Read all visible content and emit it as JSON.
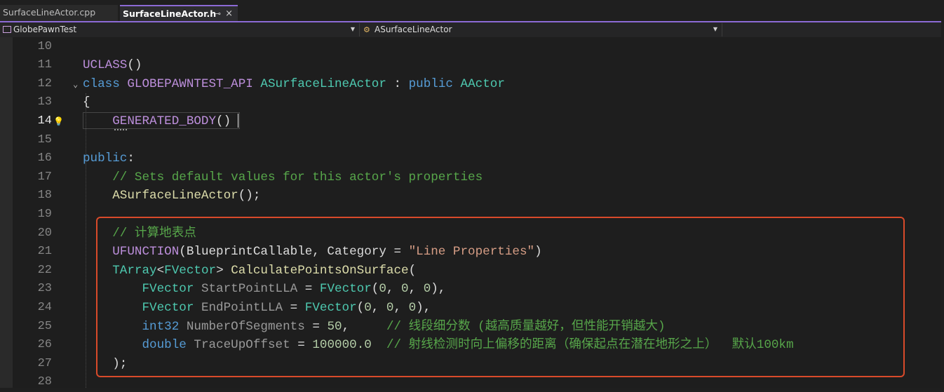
{
  "tabs": [
    {
      "label": "SurfaceLineActor.cpp",
      "active": false
    },
    {
      "label": "SurfaceLineActor.h",
      "active": true,
      "pin_icon": "pin-icon",
      "close_icon": "close-icon"
    }
  ],
  "tab_pin_glyph": "⊸",
  "tab_close_glyph": "×",
  "navbar": {
    "project": "GlobePawnTest",
    "scope": "ASurfaceLineActor",
    "member": ""
  },
  "colors": {
    "accent": "#8c6ad6",
    "highlight_border": "#d94a2a",
    "keyword": "#569cd6",
    "type": "#4ec9b0",
    "macro": "#bd8fdc",
    "function": "#dcdcaa",
    "comment": "#57a64a",
    "string": "#d69d85",
    "number": "#b5cea8"
  },
  "current_line": "14",
  "lines": [
    {
      "num": "10",
      "tokens": []
    },
    {
      "num": "11",
      "tokens": [
        [
          "mac",
          "UCLASS"
        ],
        [
          "pl",
          "()"
        ]
      ]
    },
    {
      "num": "12",
      "fold": true,
      "tokens": [
        [
          "kw",
          "class"
        ],
        [
          "pl",
          " "
        ],
        [
          "mac",
          "GLOBEPAWNTEST_API"
        ],
        [
          "pl",
          " "
        ],
        [
          "ty",
          "ASurfaceLineActor"
        ],
        [
          "pl",
          " : "
        ],
        [
          "kw",
          "public"
        ],
        [
          "pl",
          " "
        ],
        [
          "ty",
          "AActor"
        ]
      ]
    },
    {
      "num": "13",
      "tokens": [
        [
          "pl",
          "{"
        ]
      ]
    },
    {
      "num": "14",
      "tokens": [
        [
          "pl",
          "    "
        ],
        [
          "mac",
          "GENERATED_BODY"
        ],
        [
          "pl",
          "()"
        ]
      ]
    },
    {
      "num": "15",
      "tokens": []
    },
    {
      "num": "16",
      "tokens": [
        [
          "kw",
          "public"
        ],
        [
          "pl",
          ":"
        ]
      ]
    },
    {
      "num": "17",
      "tokens": [
        [
          "pl",
          "    "
        ],
        [
          "cm",
          "// Sets default values for this actor's properties"
        ]
      ]
    },
    {
      "num": "18",
      "tokens": [
        [
          "pl",
          "    "
        ],
        [
          "fn",
          "ASurfaceLineActor"
        ],
        [
          "pl",
          "();"
        ]
      ]
    },
    {
      "num": "19",
      "tokens": []
    },
    {
      "num": "20",
      "tokens": [
        [
          "pl",
          "    "
        ],
        [
          "cm",
          "// 计算地表点"
        ]
      ]
    },
    {
      "num": "21",
      "tokens": [
        [
          "pl",
          "    "
        ],
        [
          "mac",
          "UFUNCTION"
        ],
        [
          "pl",
          "(BlueprintCallable, Category = "
        ],
        [
          "str",
          "\"Line Properties\""
        ],
        [
          "pl",
          ")"
        ]
      ]
    },
    {
      "num": "22",
      "tokens": [
        [
          "pl",
          "    "
        ],
        [
          "ty",
          "TArray"
        ],
        [
          "pl",
          "<"
        ],
        [
          "ty",
          "FVector"
        ],
        [
          "pl",
          "> "
        ],
        [
          "fn",
          "CalculatePointsOnSurface"
        ],
        [
          "pl",
          "("
        ]
      ]
    },
    {
      "num": "23",
      "tokens": [
        [
          "pl",
          "        "
        ],
        [
          "ty",
          "FVector"
        ],
        [
          "pl",
          " "
        ],
        [
          "prm",
          "StartPointLLA"
        ],
        [
          "pl",
          " = "
        ],
        [
          "ty",
          "FVector"
        ],
        [
          "pl",
          "("
        ],
        [
          "num",
          "0"
        ],
        [
          "pl",
          ", "
        ],
        [
          "num",
          "0"
        ],
        [
          "pl",
          ", "
        ],
        [
          "num",
          "0"
        ],
        [
          "pl",
          "),"
        ]
      ]
    },
    {
      "num": "24",
      "tokens": [
        [
          "pl",
          "        "
        ],
        [
          "ty",
          "FVector"
        ],
        [
          "pl",
          " "
        ],
        [
          "prm",
          "EndPointLLA"
        ],
        [
          "pl",
          " = "
        ],
        [
          "ty",
          "FVector"
        ],
        [
          "pl",
          "("
        ],
        [
          "num",
          "0"
        ],
        [
          "pl",
          ", "
        ],
        [
          "num",
          "0"
        ],
        [
          "pl",
          ", "
        ],
        [
          "num",
          "0"
        ],
        [
          "pl",
          "),"
        ]
      ]
    },
    {
      "num": "25",
      "tokens": [
        [
          "pl",
          "        "
        ],
        [
          "kw",
          "int32"
        ],
        [
          "pl",
          " "
        ],
        [
          "prm",
          "NumberOfSegments"
        ],
        [
          "pl",
          " = "
        ],
        [
          "num",
          "50"
        ],
        [
          "pl",
          ",     "
        ],
        [
          "cm",
          "// 线段细分数 (越高质量越好，但性能开销越大)"
        ]
      ]
    },
    {
      "num": "26",
      "tokens": [
        [
          "pl",
          "        "
        ],
        [
          "kw",
          "double"
        ],
        [
          "pl",
          " "
        ],
        [
          "prm",
          "TraceUpOffset"
        ],
        [
          "pl",
          " = "
        ],
        [
          "num",
          "100000.0"
        ],
        [
          "pl",
          "  "
        ],
        [
          "cm",
          "// 射线检测时向上偏移的距离（确保起点在潜在地形之上）  默认100km"
        ]
      ]
    },
    {
      "num": "27",
      "tokens": [
        [
          "pl",
          "    );"
        ]
      ]
    },
    {
      "num": "28",
      "tokens": []
    }
  ]
}
